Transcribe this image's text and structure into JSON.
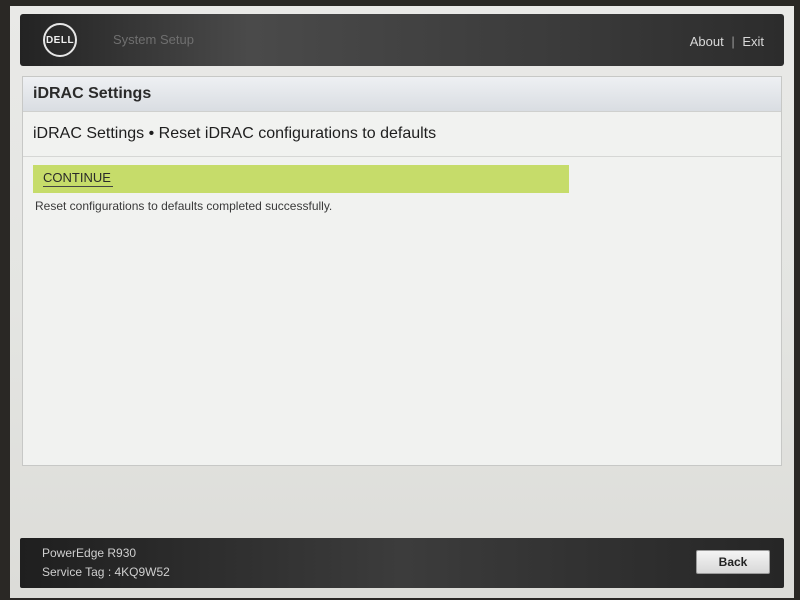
{
  "header": {
    "logo_text": "DELL",
    "app_title": "System Setup",
    "about_label": "About",
    "separator": "|",
    "exit_label": "Exit"
  },
  "panel": {
    "title": "iDRAC Settings",
    "breadcrumb": "iDRAC Settings • Reset iDRAC configurations to defaults",
    "continue_label": "CONTINUE",
    "status_message": "Reset configurations to defaults completed successfully.",
    "highlight_color": "#c6dc6a"
  },
  "footer": {
    "model": "PowerEdge R930",
    "service_tag": "Service Tag : 4KQ9W52",
    "back_label": "Back"
  }
}
